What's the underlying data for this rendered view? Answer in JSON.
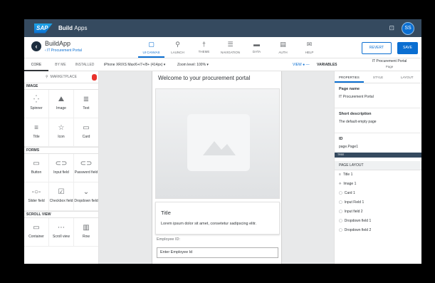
{
  "shell": {
    "logo": "SAP",
    "title_bold": "Build",
    "title_rest": "Apps",
    "avatar": "SS"
  },
  "app": {
    "name": "BuildApp",
    "page": "‹ IT Procurement Portal"
  },
  "nav_tabs": [
    {
      "label": "UI CANVAS",
      "icon": "ui-canvas-icon",
      "glyph": "▢"
    },
    {
      "label": "LAUNCH",
      "icon": "launch-icon",
      "glyph": "⚲"
    },
    {
      "label": "THEME",
      "icon": "theme-icon",
      "glyph": "†"
    },
    {
      "label": "NAVIGATION",
      "icon": "navigation-icon",
      "glyph": "☰"
    },
    {
      "label": "DATA",
      "icon": "data-icon",
      "glyph": "▬"
    },
    {
      "label": "AUTH",
      "icon": "auth-icon",
      "glyph": "▤"
    },
    {
      "label": "HELP",
      "icon": "help-icon",
      "glyph": "✉"
    }
  ],
  "actions": {
    "revert": "REVERT",
    "save": "SAVE"
  },
  "toolbar": {
    "comp_tabs": [
      "CORE",
      "BY ME",
      "INSTALLED"
    ],
    "device": "iPhone XR/XS Max/6+/7+/8+ (414px) ▾",
    "zoom": "Zoom level: 100% ▾",
    "view": "VIEW ● —",
    "variables": "VARIABLES",
    "panel_title": "IT Procurement Portal",
    "panel_sub": "Page"
  },
  "left": {
    "marketplace": "MARKETPLACE",
    "sections": {
      "image": "IMAGE",
      "forms": "FORMS",
      "scroll": "SCROLL VIEW"
    },
    "image_items": [
      {
        "label": "Spinner",
        "glyph": "⁛"
      },
      {
        "label": "Image",
        "glyph": "⛰"
      },
      {
        "label": "Text",
        "glyph": "≣"
      },
      {
        "label": "Title",
        "glyph": "≡"
      },
      {
        "label": "Icon",
        "glyph": "☆"
      },
      {
        "label": "Card",
        "glyph": "▭"
      }
    ],
    "form_items": [
      {
        "label": "Button",
        "glyph": "▭"
      },
      {
        "label": "Input field",
        "glyph": "⊂⊃"
      },
      {
        "label": "Password field",
        "glyph": "⊂⊃"
      },
      {
        "label": "Slider field",
        "glyph": "-○-"
      },
      {
        "label": "Checkbox field",
        "glyph": "☑"
      },
      {
        "label": "Dropdown field",
        "glyph": "⌄"
      }
    ],
    "scroll_items": [
      {
        "label": "Container",
        "glyph": "▭"
      },
      {
        "label": "Scroll view",
        "glyph": "⋯"
      },
      {
        "label": "Row",
        "glyph": "▥"
      }
    ]
  },
  "canvas": {
    "welcome": "Welcome to your procurement portal",
    "card_title": "Title",
    "card_body": "Lorem ipsum dolor sit amet, consetetur sadipscing elitr.",
    "emp_label": "Employee ID:",
    "emp_placeholder": "Enter Employee Id"
  },
  "right": {
    "tabs": [
      "PROPERTIES",
      "STYLE",
      "LAYOUT"
    ],
    "page_name_label": "Page name",
    "page_name_value": "IT Procurement Portal",
    "short_desc_label": "Short description",
    "short_desc_value": "The default empty page",
    "id_label": "ID",
    "id_value": "page.Page1",
    "tree_bar": "TREE",
    "page_layout": "PAGE LAYOUT",
    "tree_items": [
      {
        "glyph": "≡",
        "label": "Title 1"
      },
      {
        "glyph": "⟡",
        "label": "Image 1"
      },
      {
        "glyph": "▢",
        "label": "Card 1"
      },
      {
        "glyph": "▢",
        "label": "Input Field 1"
      },
      {
        "glyph": "▢",
        "label": "Input field 2"
      },
      {
        "glyph": "▢",
        "label": "Dropdown field 1"
      },
      {
        "glyph": "▢",
        "label": "Dropdown field 2"
      }
    ]
  }
}
